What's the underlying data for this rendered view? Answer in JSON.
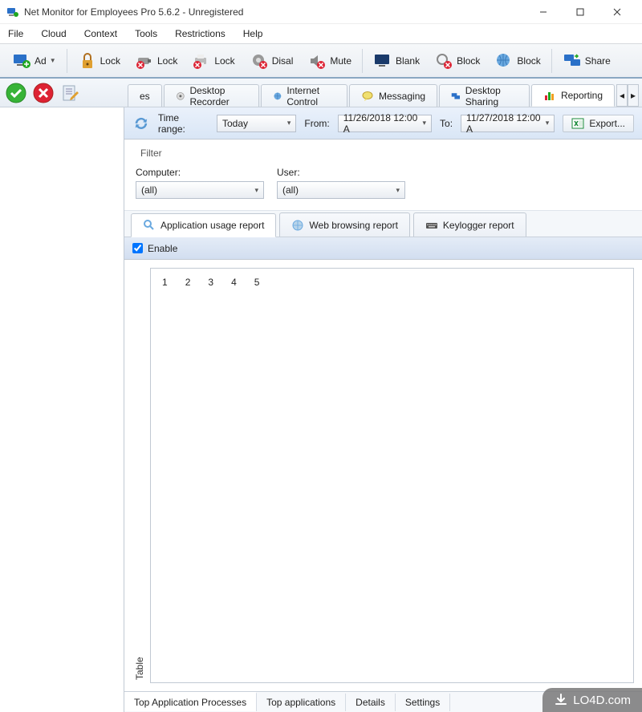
{
  "window": {
    "title": "Net Monitor for Employees Pro 5.6.2 - Unregistered"
  },
  "menu": {
    "items": [
      "File",
      "Cloud",
      "Context",
      "Tools",
      "Restrictions",
      "Help"
    ]
  },
  "toolbar": {
    "add": "Ad",
    "lock1": "Lock",
    "lock2": "Lock",
    "lock3": "Lock",
    "disable": "Disal",
    "mute": "Mute",
    "blank": "Blank",
    "block1": "Block",
    "block2": "Block",
    "share": "Share"
  },
  "maintabs": {
    "partial": "es",
    "desktop_recorder": "Desktop Recorder",
    "internet_control": "Internet Control",
    "messaging": "Messaging",
    "desktop_sharing": "Desktop Sharing",
    "reporting": "Reporting"
  },
  "timebar": {
    "time_range_label": "Time range:",
    "time_range_value": "Today",
    "from_label": "From:",
    "from_value": "11/26/2018 12:00 A",
    "to_label": "To:",
    "to_value": "11/27/2018 12:00 A",
    "export": "Export..."
  },
  "filter": {
    "title": "Filter",
    "computer_label": "Computer:",
    "computer_value": "(all)",
    "user_label": "User:",
    "user_value": "(all)"
  },
  "reporttabs": {
    "app_usage": "Application usage report",
    "web_browsing": "Web browsing report",
    "keylogger": "Keylogger report"
  },
  "enable": {
    "label": "Enable",
    "checked": true
  },
  "table": {
    "side_label": "Table",
    "columns": [
      "1",
      "2",
      "3",
      "4",
      "5"
    ]
  },
  "bottomtabs": {
    "top_processes": "Top Application Processes",
    "top_apps": "Top applications",
    "details": "Details",
    "settings": "Settings"
  },
  "watermark": "LO4D.com"
}
